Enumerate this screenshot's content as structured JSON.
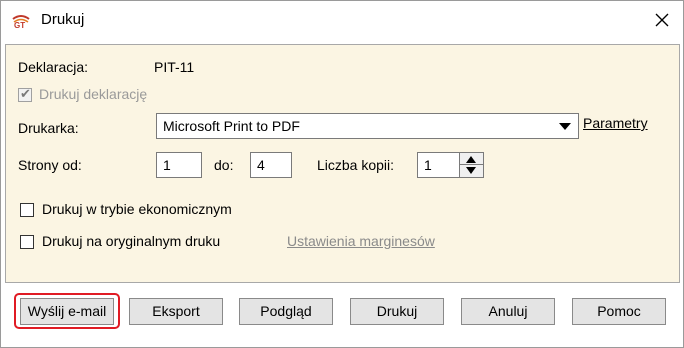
{
  "window": {
    "title": "Drukuj",
    "close_icon": "close-icon",
    "app_icon": "gt-logo-icon"
  },
  "form": {
    "deklaracja_label": "Deklaracja:",
    "deklaracja_value": "PIT-11",
    "drukuj_deklaracje_label": "Drukuj deklarację",
    "drukuj_deklaracje_checked": true,
    "drukarka_label": "Drukarka:",
    "drukarka_value": "Microsoft Print to PDF",
    "parametry_link": "Parametry",
    "strony_od_label": "Strony od:",
    "strony_od_value": "1",
    "do_label": "do:",
    "do_value": "4",
    "liczba_kopii_label": "Liczba kopii:",
    "liczba_kopii_value": "1",
    "tryb_ekonomiczny_label": "Drukuj w trybie ekonomicznym",
    "tryb_ekonomiczny_checked": false,
    "oryginalny_druk_label": "Drukuj na oryginalnym druku",
    "oryginalny_druk_checked": false,
    "marginesy_link": "Ustawienia marginesów"
  },
  "buttons": {
    "email": "Wyślij e-mail",
    "eksport": "Eksport",
    "podglad": "Podgląd",
    "drukuj": "Drukuj",
    "anuluj": "Anuluj",
    "pomoc": "Pomoc"
  },
  "colors": {
    "panel_bg": "#fbf5e3",
    "highlight": "#e01b24"
  }
}
